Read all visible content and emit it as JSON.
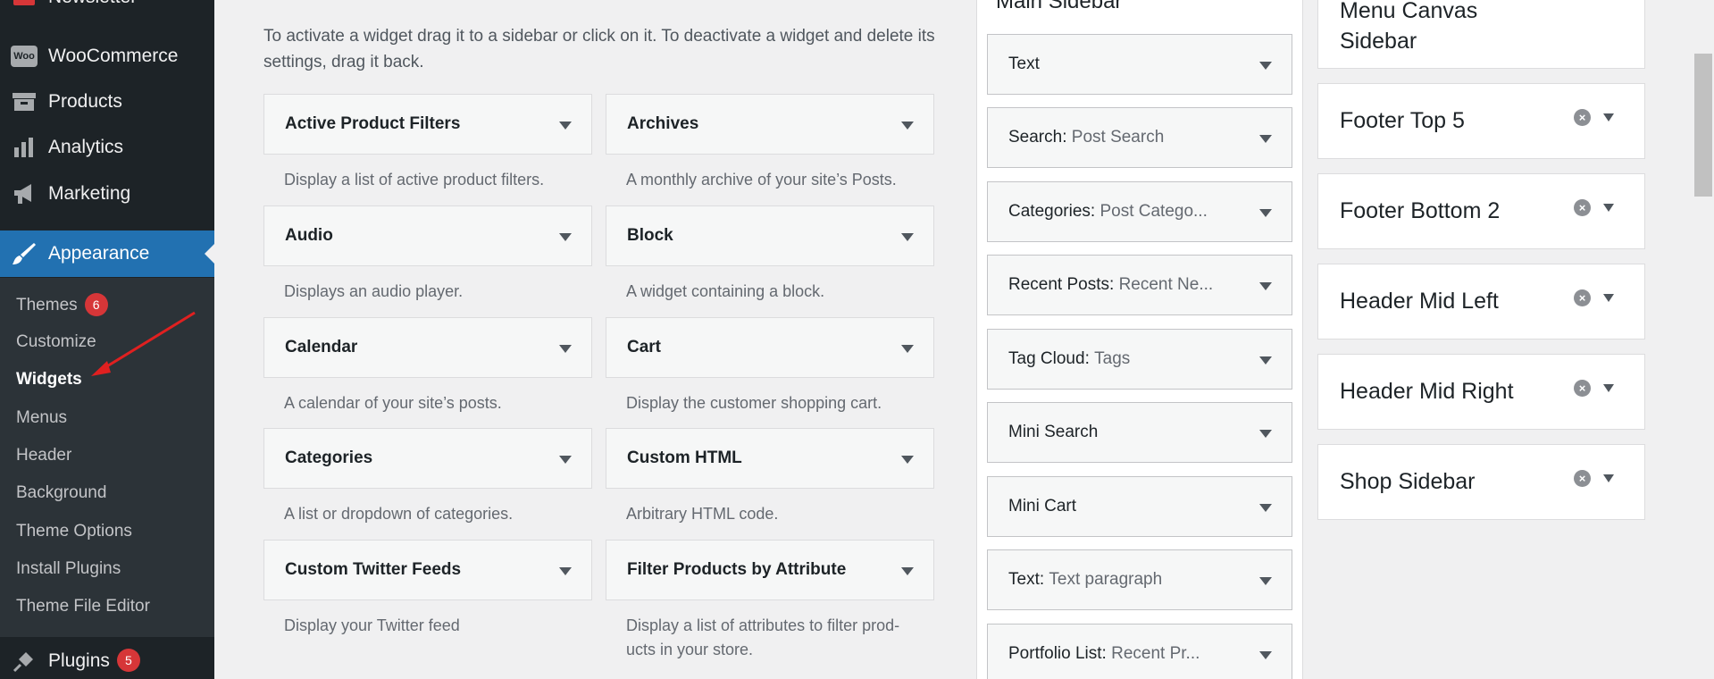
{
  "admin_menu": {
    "items": [
      {
        "label": "Newsletter",
        "icon": "newsletter-icon"
      },
      {
        "label": "WooCommerce",
        "icon": "woo-icon",
        "icon_text": "Woo"
      },
      {
        "label": "Products",
        "icon": "products-icon"
      },
      {
        "label": "Analytics",
        "icon": "analytics-icon"
      },
      {
        "label": "Marketing",
        "icon": "megaphone-icon"
      },
      {
        "label": "Appearance",
        "icon": "brush-icon"
      },
      {
        "label": "Plugins",
        "icon": "plugin-icon",
        "badge": "5"
      }
    ],
    "submenu": [
      {
        "label": "Themes",
        "badge": "6"
      },
      {
        "label": "Customize"
      },
      {
        "label": "Widgets"
      },
      {
        "label": "Menus"
      },
      {
        "label": "Header"
      },
      {
        "label": "Background"
      },
      {
        "label": "Theme Options"
      },
      {
        "label": "Install Plugins"
      },
      {
        "label": "Theme File Editor"
      }
    ]
  },
  "available": {
    "description": "To activate a widget drag it to a sidebar or click on it. To deactivate a widget and delete its settings, drag it back.",
    "widgets": [
      {
        "title": "Active Product Filters",
        "desc": "Display a list of active product filters."
      },
      {
        "title": "Archives",
        "desc": "A monthly archive of your site’s Posts."
      },
      {
        "title": "Audio",
        "desc": "Displays an audio player."
      },
      {
        "title": "Block",
        "desc": "A widget containing a block."
      },
      {
        "title": "Calendar",
        "desc": "A calendar of your site’s posts."
      },
      {
        "title": "Cart",
        "desc": "Display the customer shopping cart."
      },
      {
        "title": "Categories",
        "desc": "A list or dropdown of categories."
      },
      {
        "title": "Custom HTML",
        "desc": "Arbitrary HTML code."
      },
      {
        "title": "Custom Twitter Feeds",
        "desc": "Display your Twitter feed"
      },
      {
        "title": "Filter Products by Attribute",
        "desc_line1": "Display a list of attributes to filter prod-",
        "desc_line2": "ucts in your store."
      }
    ]
  },
  "main_sidebar": {
    "title": "Main Sidebar",
    "widgets": [
      {
        "name": "Text",
        "sub": ""
      },
      {
        "name": "Search",
        "sub": "Post Search"
      },
      {
        "name": "Categories",
        "sub": "Post Catego..."
      },
      {
        "name": "Recent Posts",
        "sub": "Recent Ne..."
      },
      {
        "name": "Tag Cloud",
        "sub": "Tags"
      },
      {
        "name": "Mini Search",
        "sub": ""
      },
      {
        "name": "Mini Cart",
        "sub": ""
      },
      {
        "name": "Text",
        "sub": "Text paragraph"
      },
      {
        "name": "Portfolio List",
        "sub": "Recent Pr..."
      }
    ]
  },
  "sidebars": [
    {
      "title_line1": "Menu Canvas",
      "title_line2": "Sidebar"
    },
    {
      "title": "Footer Top 5"
    },
    {
      "title": "Footer Bottom 2"
    },
    {
      "title": "Header Mid Left"
    },
    {
      "title": "Header Mid Right"
    },
    {
      "title": "Shop Sidebar"
    }
  ],
  "colors": {
    "admin_bg": "#1d2327",
    "submenu_bg": "#2c3338",
    "accent": "#2271b1",
    "badge": "#d63638",
    "arrow_annotation": "#e02020"
  }
}
